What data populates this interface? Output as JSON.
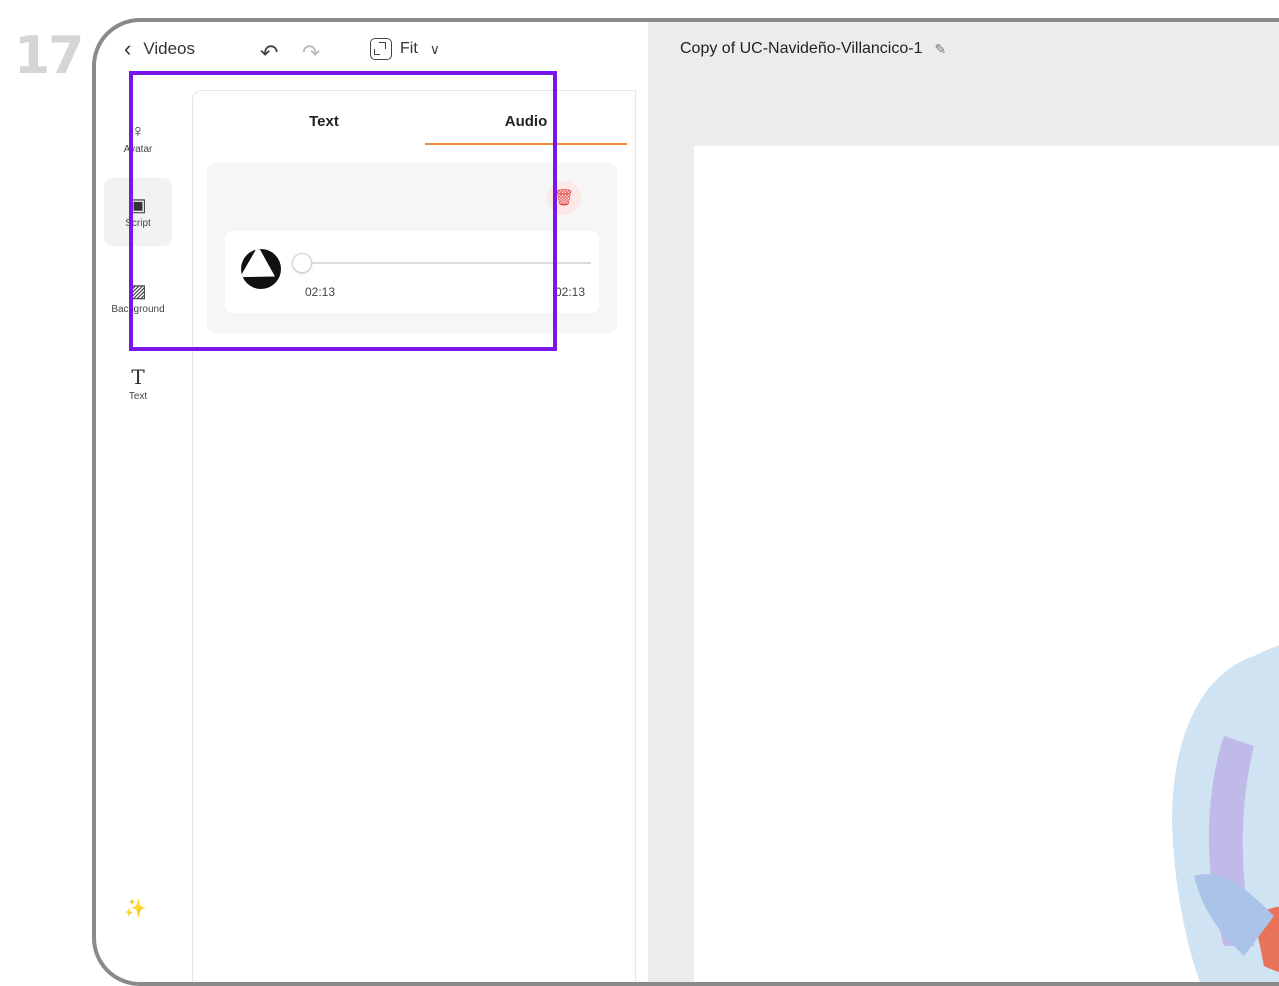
{
  "step_number": "17",
  "topbar": {
    "back_label": "Videos",
    "fit_label": "Fit"
  },
  "rail": {
    "items": [
      {
        "label": "Avatar",
        "icon": "person-icon"
      },
      {
        "label": "Script",
        "icon": "chat-icon"
      },
      {
        "label": "Background",
        "icon": "hatch-icon"
      },
      {
        "label": "Text",
        "icon": "text-icon"
      }
    ],
    "active": "Script"
  },
  "panel": {
    "tabs": [
      {
        "label": "Text"
      },
      {
        "label": "Audio"
      }
    ],
    "active_tab": "Audio",
    "audio": {
      "current_time": "02:13",
      "total_time": "02:13",
      "progress": 0.0
    }
  },
  "canvas": {
    "project_title": "Copy of UC-Navideño-Villancico-1"
  },
  "colors": {
    "accent": "#f08a3c",
    "highlight": "#7b16e8",
    "delete": "#e04646"
  }
}
